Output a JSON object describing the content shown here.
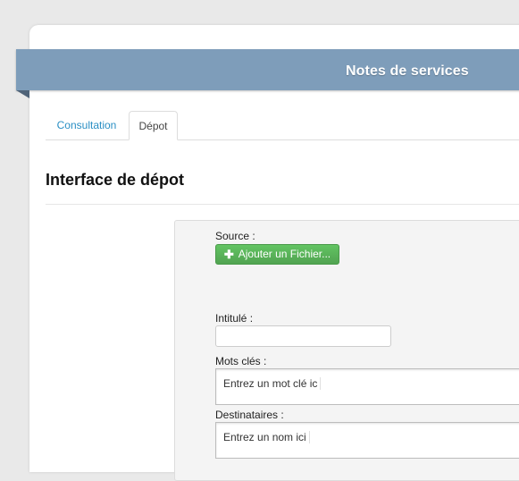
{
  "header": {
    "title": "Notes de services"
  },
  "tabs": [
    {
      "label": "Consultation",
      "active": false
    },
    {
      "label": "Dépot",
      "active": true
    }
  ],
  "page": {
    "heading": "Interface de dépot"
  },
  "form": {
    "source_label": "Source :",
    "add_file_button": "Ajouter un Fichier...",
    "title_label": "Intitulé :",
    "title_value": "",
    "keywords_label": "Mots clés :",
    "keywords_placeholder": "Entrez un mot clé ic",
    "recipients_label": "Destinataires :",
    "recipients_placeholder": "Entrez un nom ici"
  },
  "colors": {
    "banner": "#7e9dba",
    "link": "#2a8fc4",
    "success_button": "#5bb75b"
  }
}
